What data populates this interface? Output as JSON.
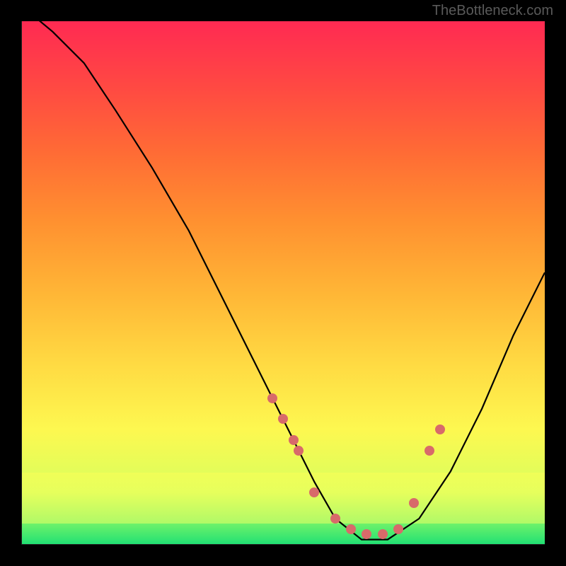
{
  "watermark": "TheBottleneck.com",
  "chart_data": {
    "type": "line",
    "title": "",
    "xlabel": "",
    "ylabel": "",
    "xlim": [
      0,
      100
    ],
    "ylim": [
      0,
      100
    ],
    "series": [
      {
        "name": "bottleneck-curve",
        "x": [
          0,
          6,
          12,
          18,
          25,
          32,
          38,
          44,
          50,
          56,
          60,
          65,
          70,
          76,
          82,
          88,
          94,
          100
        ],
        "y": [
          103,
          98,
          92,
          83,
          72,
          60,
          48,
          36,
          24,
          12,
          5,
          1,
          1,
          5,
          14,
          26,
          40,
          52
        ]
      }
    ],
    "markers": {
      "name": "highlighted-points",
      "x": [
        48,
        50,
        52,
        53,
        56,
        60,
        63,
        66,
        69,
        72,
        75,
        78,
        80
      ],
      "y": [
        28,
        24,
        20,
        18,
        10,
        5,
        3,
        2,
        2,
        3,
        8,
        18,
        22
      ]
    },
    "background_gradient": {
      "top": "#ff2a52",
      "middle": "#ffd942",
      "bottom": "#1fe074"
    },
    "bands": [
      {
        "name": "green-optimal",
        "from_y": 0,
        "to_y": 4,
        "color": "#1fe074"
      },
      {
        "name": "yellow-near",
        "from_y": 4,
        "to_y": 14,
        "color": "#fbff55"
      }
    ]
  }
}
